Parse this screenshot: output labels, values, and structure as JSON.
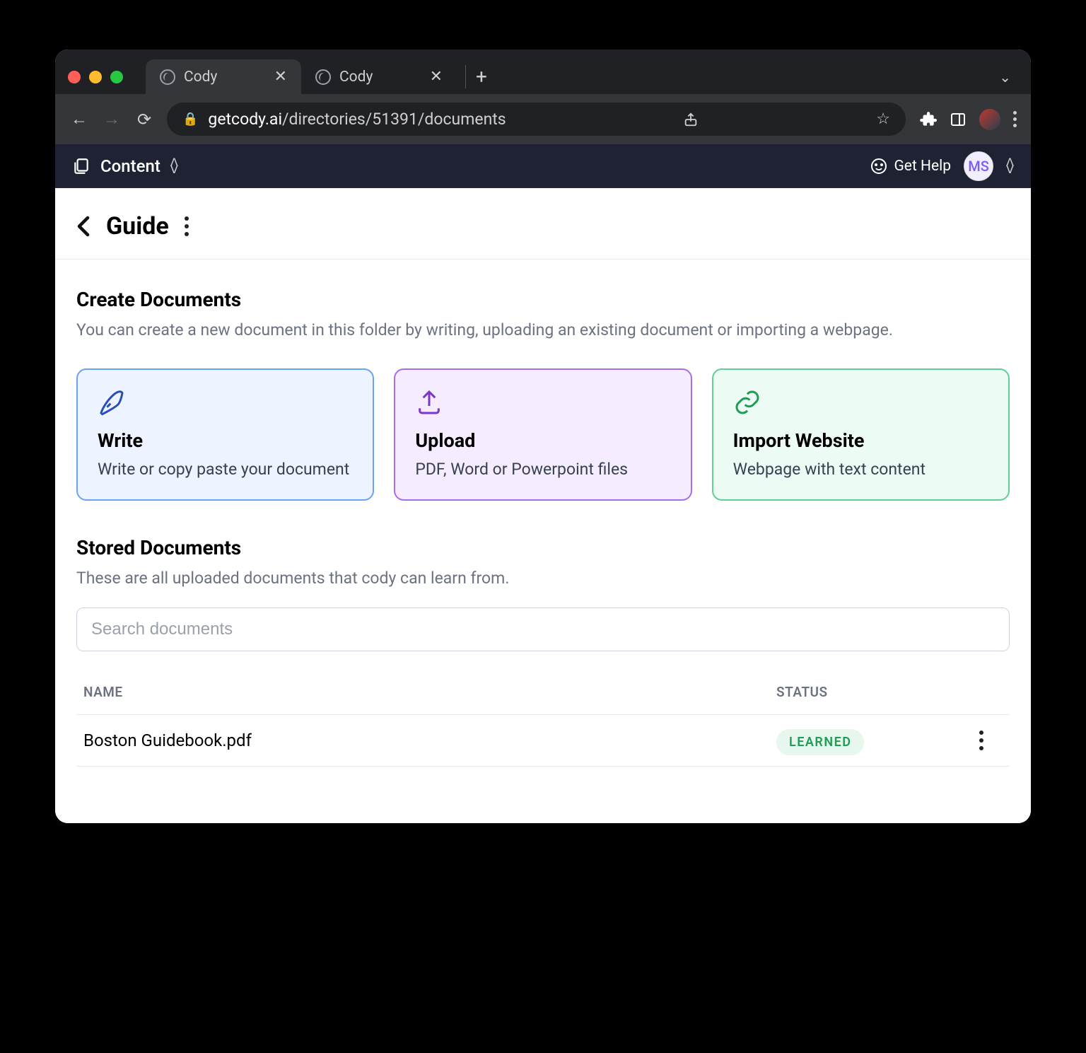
{
  "browser": {
    "tabs": [
      {
        "title": "Cody",
        "active": true
      },
      {
        "title": "Cody",
        "active": false
      }
    ],
    "url_domain": "getcody.ai",
    "url_path": "/directories/51391/documents"
  },
  "app_bar": {
    "section": "Content",
    "help": "Get Help",
    "user_initials": "MS"
  },
  "page_header": {
    "title": "Guide"
  },
  "create_section": {
    "title": "Create Documents",
    "subtitle": "You can create a new document in this folder by writing, uploading an existing document or importing a webpage."
  },
  "cards": {
    "write": {
      "title": "Write",
      "desc": "Write or copy paste your document"
    },
    "upload": {
      "title": "Upload",
      "desc": "PDF, Word or Powerpoint files"
    },
    "import": {
      "title": "Import Website",
      "desc": "Webpage with text content"
    }
  },
  "stored_section": {
    "title": "Stored Documents",
    "subtitle": "These are all uploaded documents that cody can learn from."
  },
  "search": {
    "placeholder": "Search documents"
  },
  "table": {
    "headers": {
      "name": "NAME",
      "status": "STATUS"
    },
    "rows": [
      {
        "name": "Boston Guidebook.pdf",
        "status": "LEARNED"
      }
    ]
  }
}
